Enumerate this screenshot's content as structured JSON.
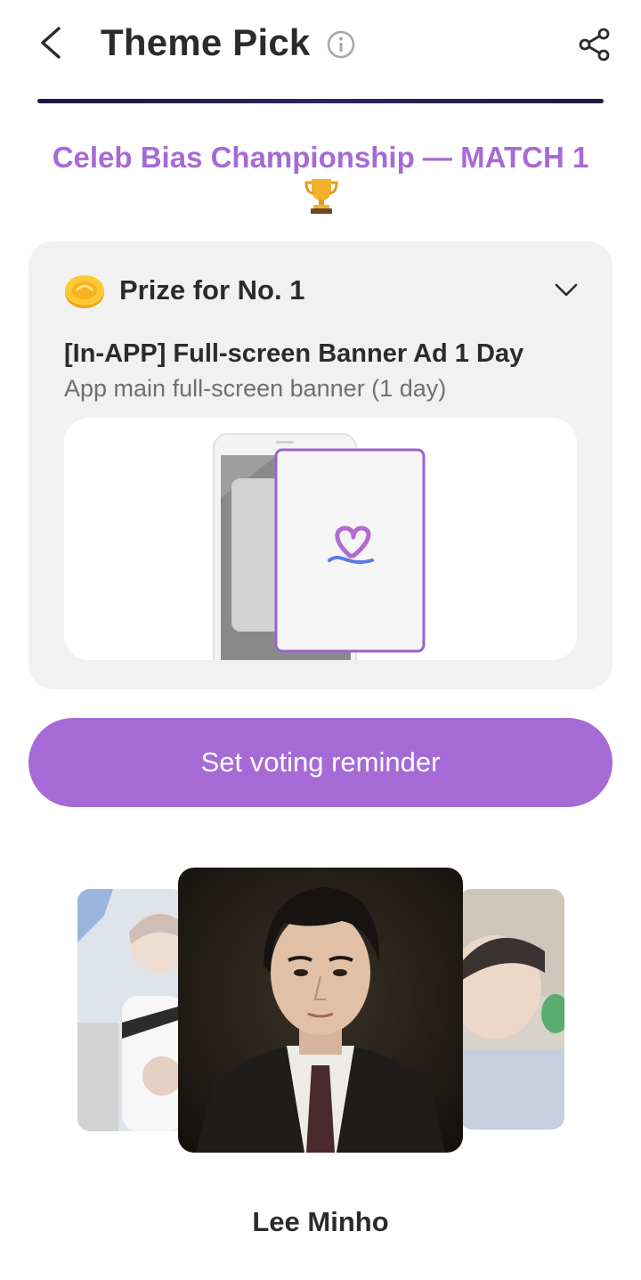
{
  "header": {
    "title": "Theme Pick",
    "back_icon": "chevron-left-icon",
    "info_icon": "info-circle-icon",
    "share_icon": "share-icon"
  },
  "championship": {
    "title": "Celeb Bias Championship — MATCH 1",
    "icon": "trophy-icon"
  },
  "prize": {
    "label": "Prize for No. 1",
    "name": "[In-APP] Full-screen Banner Ad 1 Day",
    "description": "App main full-screen banner (1 day)",
    "coin_icon": "coin-icon",
    "expand_icon": "chevron-down-icon"
  },
  "reminder_button": {
    "label": "Set voting reminder"
  },
  "carousel": {
    "current_name": "Lee Minho",
    "cards": [
      "left-celeb-photo",
      "lee-minho-photo",
      "right-celeb-photo"
    ]
  },
  "colors": {
    "accent": "#a66ad6",
    "card_bg": "#f1f1f1",
    "text": "#2b2b2b"
  }
}
